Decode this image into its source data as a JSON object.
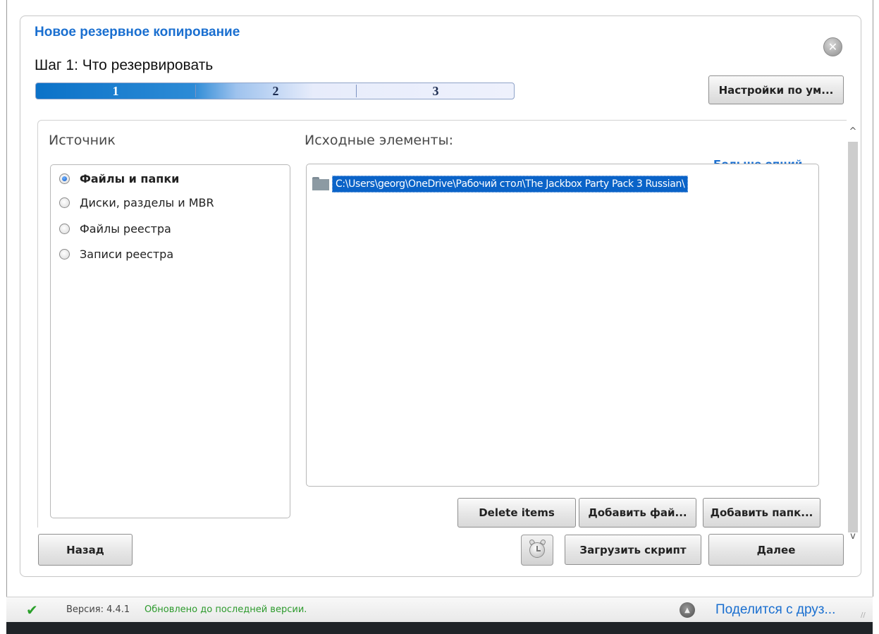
{
  "dialog": {
    "title": "Новое резервное копирование",
    "step_title": "Шаг 1: Что резервировать",
    "close_glyph": "✕",
    "progress": {
      "steps": [
        "1",
        "2",
        "3"
      ],
      "current_step": 1
    },
    "defaults_button": "Настройки по ум..."
  },
  "source": {
    "label": "Источник",
    "options": [
      {
        "label": "Файлы и папки",
        "selected": true
      },
      {
        "label": "Диски, разделы и MBR",
        "selected": false
      },
      {
        "label": "Файлы реестра",
        "selected": false
      },
      {
        "label": "Записи реестра",
        "selected": false
      }
    ]
  },
  "items": {
    "label": "Исходные элементы:",
    "more_options": "Больше опций",
    "entries": [
      "C:\\Users\\georg\\OneDrive\\Рабочий стол\\The Jackbox Party Pack 3 Russian\\"
    ]
  },
  "item_buttons": {
    "delete": "Delete items",
    "add_file": "Добавить фай...",
    "add_folder": "Добавить папк..."
  },
  "footer_buttons": {
    "back": "Назад",
    "load_script": "Загрузить скрипт",
    "next": "Далее"
  },
  "scrollbar": {
    "up_glyph": "^",
    "down_glyph": "v"
  },
  "status_bar": {
    "version_label": "Версия: 4.4.1",
    "status_text": "Обновлено до последней версии.",
    "share_text": "Поделится с друз...",
    "share_glyph": "▲"
  },
  "colors": {
    "accent": "#1a6fd0",
    "selection": "#0a63c8",
    "ok_green": "#2c9a2c"
  }
}
